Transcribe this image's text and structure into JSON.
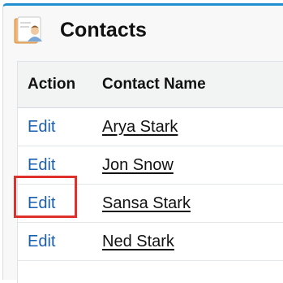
{
  "header": {
    "title": "Contacts",
    "icon": "contacts-icon"
  },
  "table": {
    "columns": [
      "Action",
      "Contact Name"
    ],
    "rows": [
      {
        "action": "Edit",
        "name": "Arya Stark"
      },
      {
        "action": "Edit",
        "name": "Jon Snow"
      },
      {
        "action": "Edit",
        "name": "Sansa Stark",
        "highlighted": true
      },
      {
        "action": "Edit",
        "name": "Ned Stark"
      }
    ]
  },
  "colors": {
    "accent": "#1f8fcf",
    "link": "#1a5fb0",
    "highlight": "#e0302c"
  }
}
